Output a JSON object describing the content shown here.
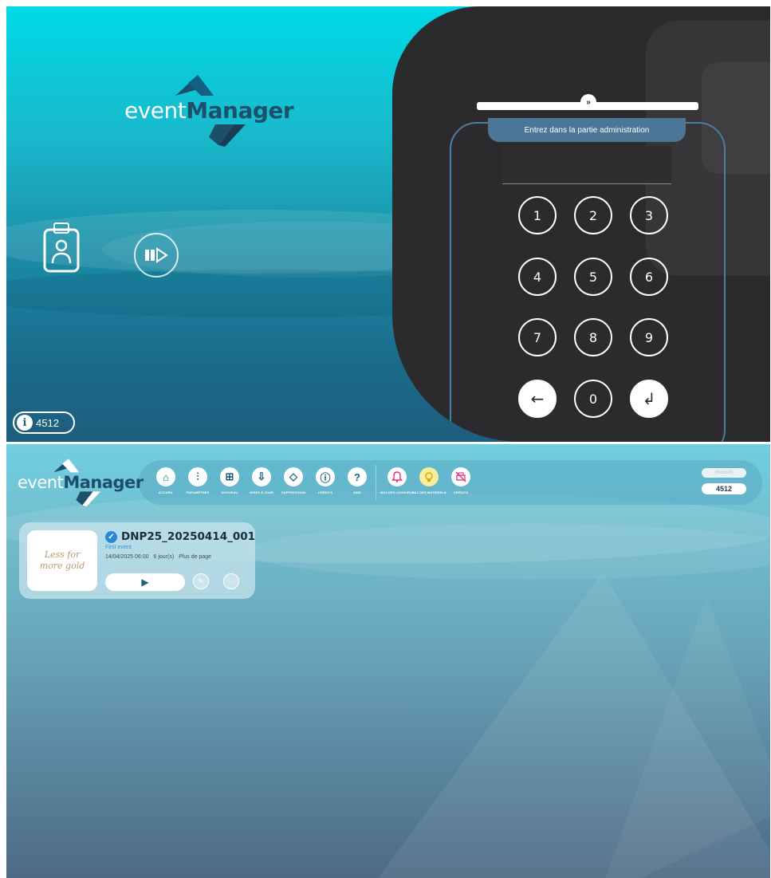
{
  "brand": {
    "word1": "event",
    "word2": "Manager"
  },
  "top_screen": {
    "badge_icon": "employee-badge-icon",
    "slideshow_icon": "play-sequence-icon",
    "info_code": "4512",
    "admin": {
      "title": "Entrez dans la partie administration",
      "pin_value": "",
      "keys": [
        "1",
        "2",
        "3",
        "4",
        "5",
        "6",
        "7",
        "8",
        "9",
        "←",
        "0",
        "↲"
      ],
      "collapse_icon": "double-chevron-down-icon"
    }
  },
  "bottom_screen": {
    "toolbar": [
      {
        "label": "ACCUEIL",
        "icon": "home-icon",
        "glyph": "⌂"
      },
      {
        "label": "PARAMÈTRES",
        "icon": "sliders-icon",
        "glyph": "⫶"
      },
      {
        "label": "NOUVEAU",
        "icon": "plus-square-icon",
        "glyph": "⊞"
      },
      {
        "label": "MISES À JOUR",
        "icon": "download-tray-icon",
        "glyph": "⇩"
      },
      {
        "label": "SUPPRESSION",
        "icon": "eraser-icon",
        "glyph": "◇"
      },
      {
        "label": "CRÉDITS",
        "icon": "info-icon",
        "glyph": "ⓘ"
      },
      {
        "label": "AIDE",
        "icon": "help-icon",
        "glyph": "?"
      },
      {
        "label": "MÀJ DES LOGICIELS",
        "icon": "bell-icon",
        "glyph": "🔔"
      },
      {
        "label": "MÀJ DES MATÉRIELS",
        "icon": "lightbulb-icon",
        "glyph": "💡"
      },
      {
        "label": "CRÉDITS",
        "icon": "no-print-icon",
        "glyph": "⎙"
      }
    ],
    "user_name": "(blurred)",
    "code": "4512",
    "event": {
      "thumbnail_text": "Less for more gold",
      "name": "DNP25_20250414_001",
      "subtitle": "First event",
      "date": "14/04/2025 06:00",
      "duration": "6 jour(s)",
      "layout": "Plus de page",
      "play_glyph": "▶",
      "edit_glyph": "✎",
      "more_glyph": "···"
    }
  }
}
